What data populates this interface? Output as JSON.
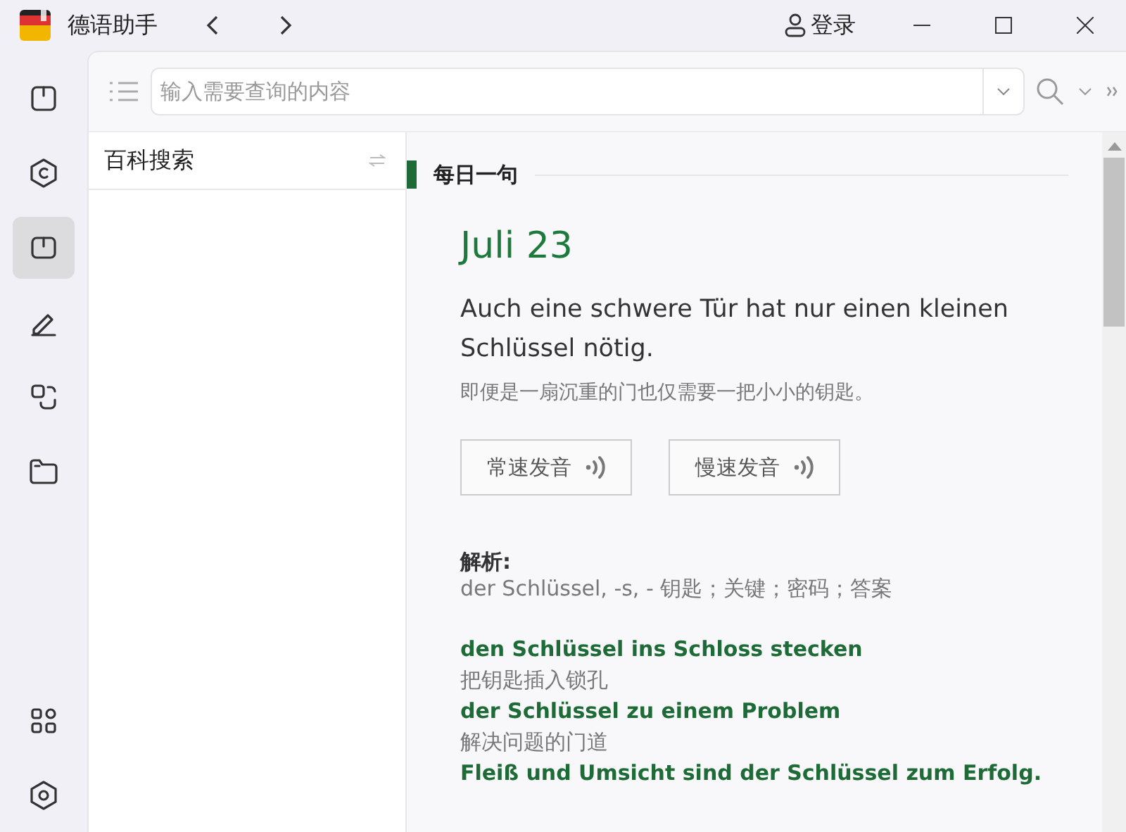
{
  "window": {
    "title": "德语助手",
    "login": "登录"
  },
  "sidebar": {
    "items": [
      {
        "selected": false
      },
      {
        "selected": false
      },
      {
        "selected": true
      },
      {
        "selected": false
      },
      {
        "selected": false
      },
      {
        "selected": false
      }
    ],
    "bottom_items": [
      {
        "selected": false
      },
      {
        "selected": false
      }
    ]
  },
  "search": {
    "placeholder": "输入需要查询的内容"
  },
  "left_panel": {
    "title": "百科搜索"
  },
  "daily": {
    "heading": "每日一句",
    "date": "Juli 23",
    "sentence": "Auch eine schwere Tür hat nur einen kleinen Schlüssel nötig.",
    "translation": "即便是一扇沉重的门也仅需要一把小小的钥匙。",
    "buttons": [
      "常速发音",
      "慢速发音"
    ],
    "analysis_label": "解析:",
    "analysis": "der Schlüssel, -s, - 钥匙；关键；密码；答案",
    "examples": [
      {
        "de": "den Schlüssel ins Schloss stecken",
        "zh": "把钥匙插入锁孔"
      },
      {
        "de": "der Schlüssel zu einem Problem",
        "zh": "解决问题的门道"
      },
      {
        "de": "Fleiß und Umsicht sind der Schlüssel zum Erfolg."
      }
    ]
  }
}
